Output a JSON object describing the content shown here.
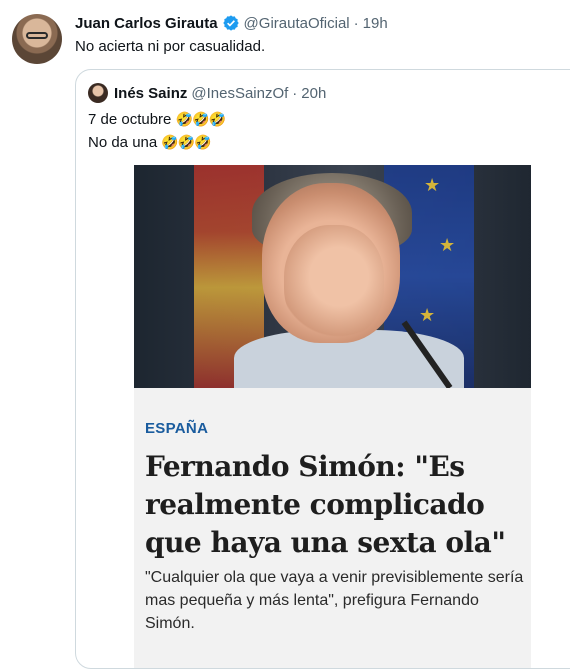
{
  "tweet": {
    "author_name": "Juan Carlos Girauta",
    "handle": "@GirautaOficial",
    "time": "19h",
    "text": "No acierta ni por casualidad."
  },
  "quoted": {
    "author_name": "Inés Sainz",
    "handle": "@InesSainzOf",
    "time": "20h",
    "line1": "7 de octubre",
    "line2": "No da una",
    "emoji": "🤣🤣🤣"
  },
  "article": {
    "kicker": "ESPAÑA",
    "headline": "Fernando Simón: \"Es realmente complicado que haya una sexta ola\"",
    "subhead": "\"Cualquier ola que vaya a venir previsiblemente sería mas pequeña y más lenta\", prefigura Fernando Simón."
  },
  "icons": {
    "verified": "verified-badge-icon"
  },
  "colors": {
    "kicker": "#1a5c9e",
    "verified": "#1d9bf0",
    "secondary_text": "#536471"
  }
}
